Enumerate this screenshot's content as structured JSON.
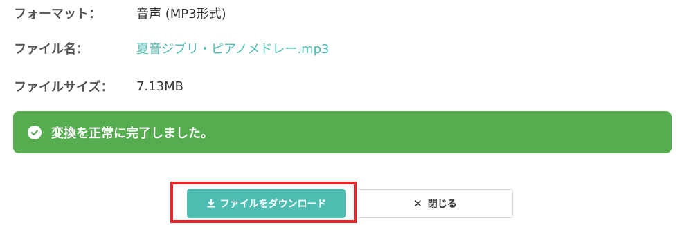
{
  "file_info": {
    "format_label": "フォーマット：",
    "format_value": "音声 (MP3形式)",
    "filename_label": "ファイル名：",
    "filename_value": "夏音ジブリ・ピアノメドレー.mp3",
    "filesize_label": "ファイルサイズ：",
    "filesize_value": "7.13MB"
  },
  "alert": {
    "message": "変換を正常に完了しました。",
    "color": "#56ad4f",
    "icon": "check-circle-icon"
  },
  "actions": {
    "download_label": "ファイルをダウンロード",
    "download_icon": "download-icon",
    "close_label": "閉じる",
    "close_icon": "close-icon",
    "accent_color": "#4fbcb2",
    "highlight_color": "#e8212b"
  }
}
